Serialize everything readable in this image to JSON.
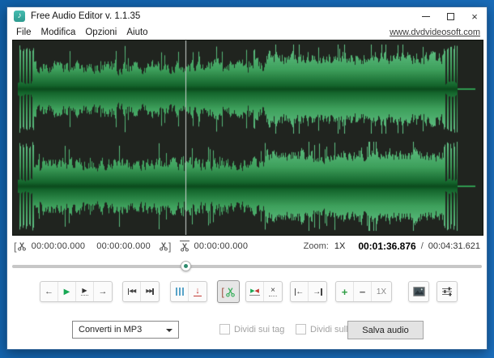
{
  "colors": {
    "desktop_blue": "#1160a8",
    "desktop_blue_light": "#1b6fbe",
    "panel_bg": "#20241f",
    "wave_tip": "#66c68b",
    "wave_mid": "#3ea05c",
    "wave_core": "#0b4a1d",
    "wave_line": "#2f9a4f",
    "playhead": "#cdd4d1",
    "play_green": "#17a854",
    "pause_blue": "#58a3c8",
    "rec_red": "#c23a34",
    "scissors_green": "#3bb05e",
    "zoom_green": "#2f9e44",
    "accent_teal": "#2e8b6e"
  },
  "window": {
    "title": "Free Audio Editor v. 1.1.35"
  },
  "icons": {
    "app_glyph": "♪",
    "close": "×",
    "back": "←",
    "forward": "→",
    "play": "▶",
    "play_selection": "▶",
    "skip_back_tris": "◀◀",
    "skip_fwd_tris": "▶▶",
    "record_down": "↓",
    "bracket_left": "[",
    "bracket_right": "]",
    "trim_left": "▶",
    "trim_right": "◀",
    "delete_x": "×",
    "to_start_arrow": "←",
    "to_end_arrow": "→",
    "zoom_in": "+",
    "zoom_out": "−",
    "zoom_reset": "1X"
  },
  "menu": {
    "items": [
      "File",
      "Modifica",
      "Opzioni",
      "Aiuto"
    ],
    "website": "www.dvdvideosoft.com"
  },
  "readout": {
    "selection_start": "00:00:00.000",
    "selection_end": "00:00:00.000",
    "cursor_position": "00:00:00.000",
    "zoom_label": "Zoom:",
    "zoom_value": "1X",
    "current_time": "00:01:36.876",
    "separator": "/",
    "total_time": "00:04:31.621"
  },
  "waveform": {
    "channels": 2,
    "playhead_fraction": 0.368,
    "signal_end_fraction": 0.947,
    "tail_end_fraction": 0.985
  },
  "slider": {
    "position_fraction": 0.368
  },
  "bottom": {
    "convert_value": "Converti in MP3",
    "split_tags_label": "Dividi sui tag",
    "split_selections_label": "Dividi sulle selezioni",
    "save_label": "Salva audio"
  }
}
